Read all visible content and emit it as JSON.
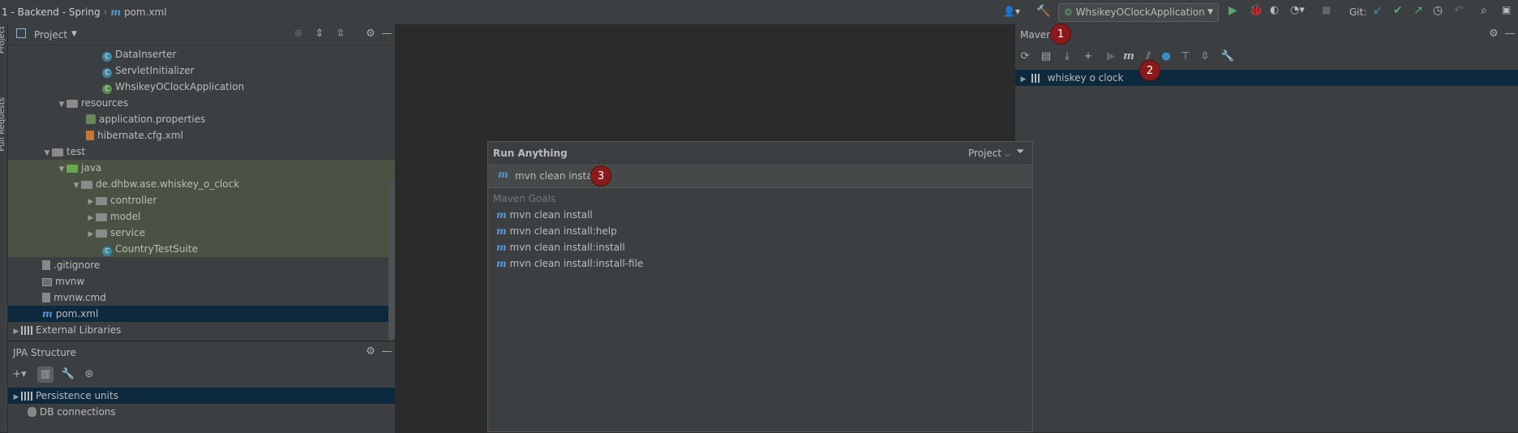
{
  "breadcrumb": {
    "project": "1 - Backend - Spring",
    "file": "pom.xml"
  },
  "run_config": {
    "name": "WhsikeyOClockApplication"
  },
  "git": {
    "label": "Git:"
  },
  "left_stripe": {
    "project_tab": "Project",
    "pull_tab": "Pull Requests"
  },
  "project_panel": {
    "title": "Project",
    "tree": [
      {
        "label": "DataInserter",
        "icon": "class-icon"
      },
      {
        "label": "ServletInitializer",
        "icon": "class-icon"
      },
      {
        "label": "WhsikeyOClockApplication",
        "icon": "spring-class-icon"
      },
      {
        "label": "resources",
        "icon": "folder-icon"
      },
      {
        "label": "application.properties",
        "icon": "spring-leaf-icon"
      },
      {
        "label": "hibernate.cfg.xml",
        "icon": "xml-file-icon"
      },
      {
        "label": "test",
        "icon": "folder-icon"
      },
      {
        "label": "java",
        "icon": "folder-green-icon"
      },
      {
        "label": "de.dhbw.ase.whiskey_o_clock",
        "icon": "package-icon"
      },
      {
        "label": "controller",
        "icon": "package-icon"
      },
      {
        "label": "model",
        "icon": "package-icon"
      },
      {
        "label": "service",
        "icon": "package-icon"
      },
      {
        "label": "CountryTestSuite",
        "icon": "class-icon"
      },
      {
        "label": ".gitignore",
        "icon": "file-icon"
      },
      {
        "label": "mvnw",
        "icon": "terminal-icon"
      },
      {
        "label": "mvnw.cmd",
        "icon": "file-icon"
      },
      {
        "label": "pom.xml",
        "icon": "maven-icon"
      },
      {
        "label": "External Libraries",
        "icon": "libraries-icon"
      }
    ]
  },
  "jpa_panel": {
    "title": "JPA Structure",
    "items": [
      {
        "label": "Persistence units"
      },
      {
        "label": "DB connections"
      }
    ]
  },
  "maven_panel": {
    "title": "Maven",
    "project": "whiskey o clock"
  },
  "run_anything": {
    "title": "Run Anything",
    "scope": "Project",
    "query": "mvn clean install",
    "section": "Maven Goals",
    "goals": [
      "mvn clean install",
      "mvn clean install:help",
      "mvn clean install:install",
      "mvn clean install:install-file"
    ]
  },
  "badges": [
    "1",
    "2",
    "3"
  ],
  "colors": {
    "accent": "#5a9ad6",
    "badge": "#8b1a1a",
    "selection": "#0d293e",
    "test_bg": "#4a5343",
    "run_green": "#59a869"
  }
}
